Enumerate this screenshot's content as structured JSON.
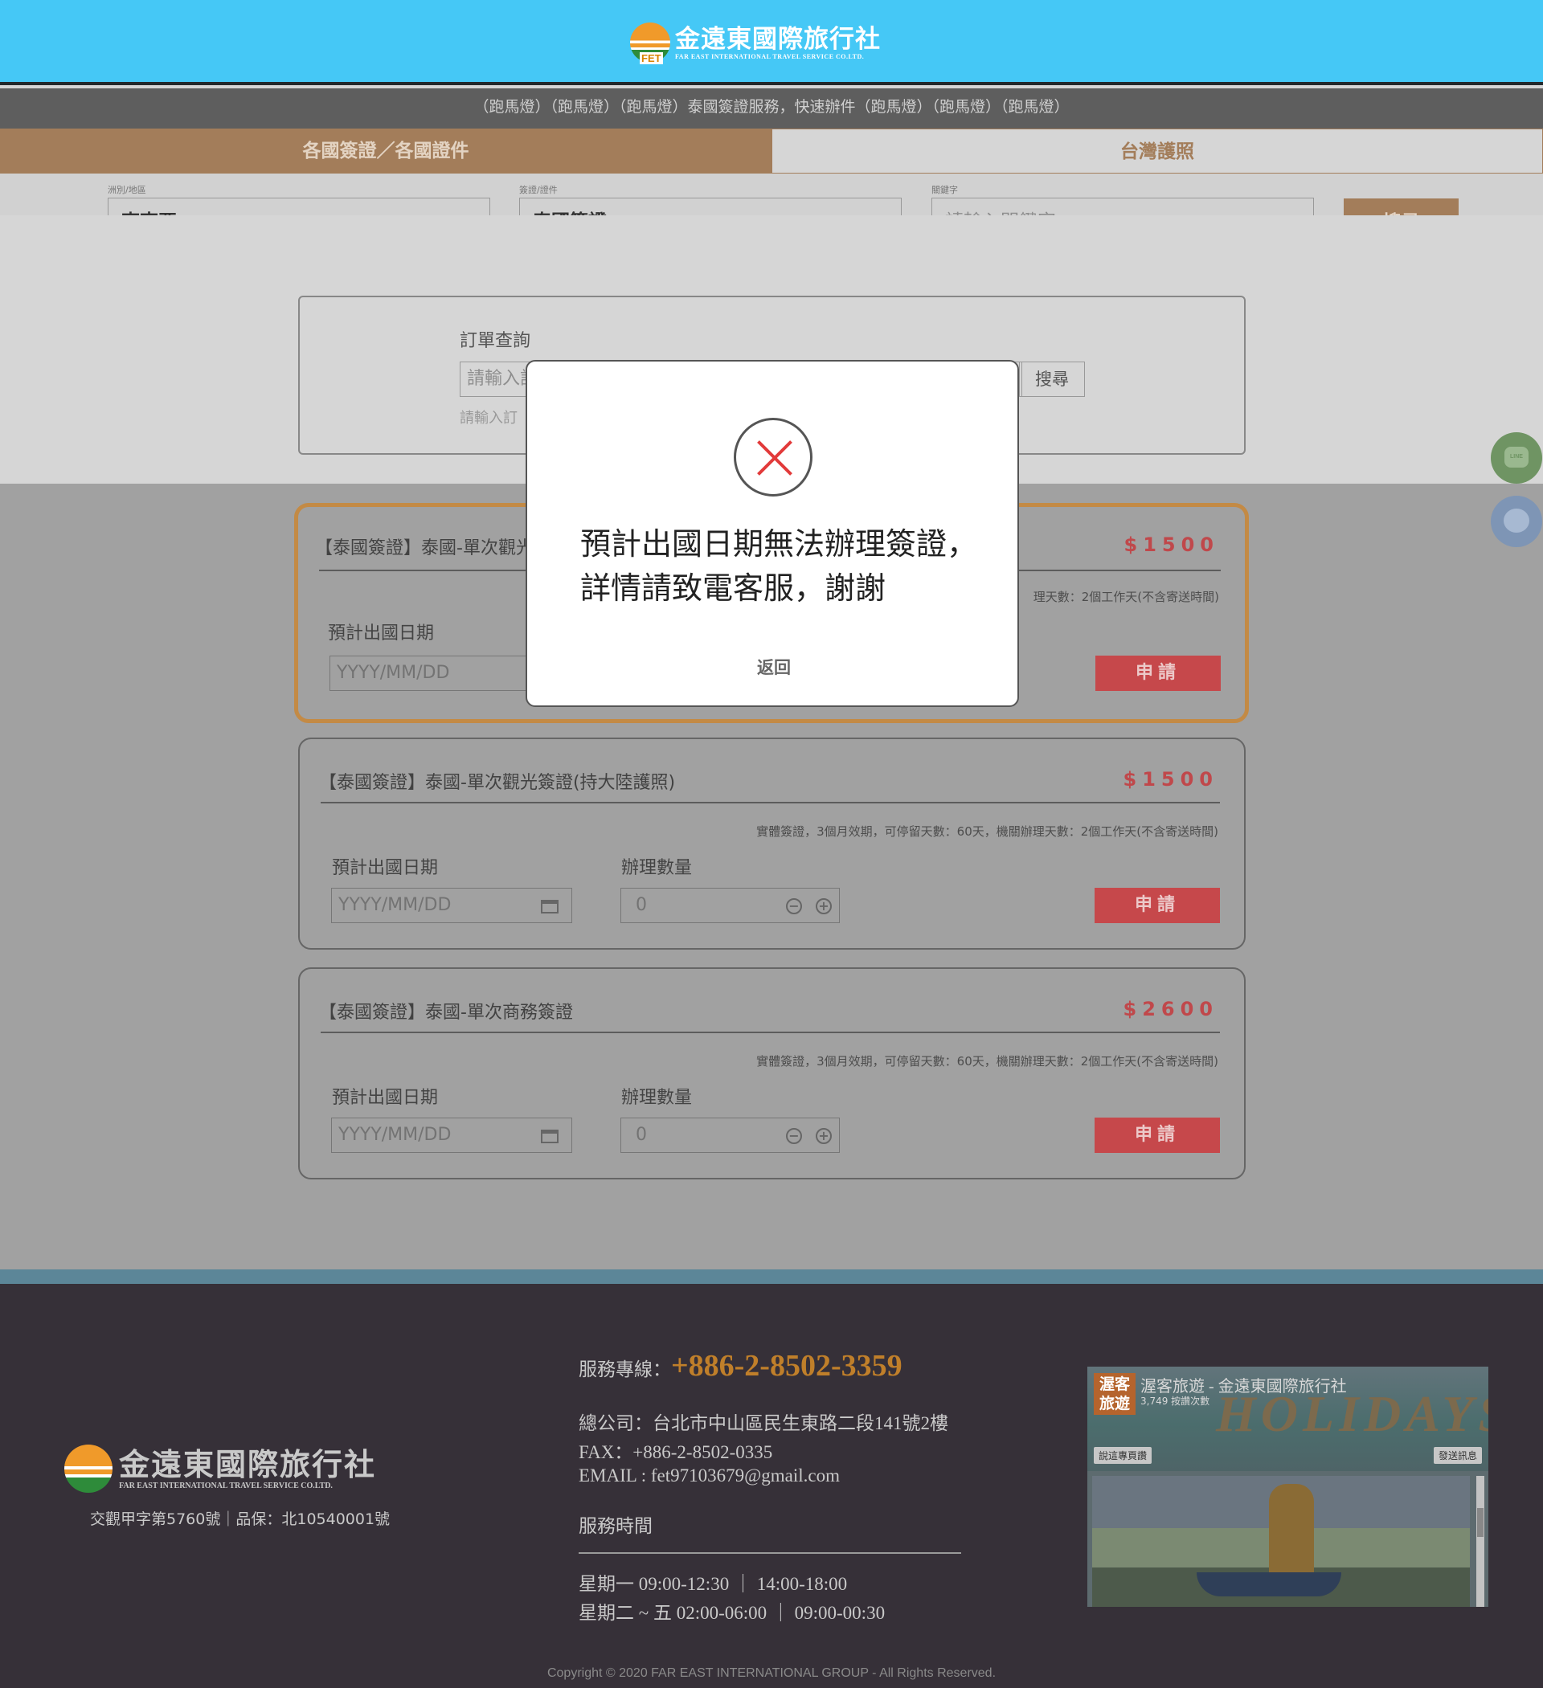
{
  "header": {
    "logo_cn": "金遠東國際旅行社",
    "logo_en": "FAR EAST INTERNATIONAL TRAVEL SERVICE CO.LTD.",
    "logo_mark": "FET"
  },
  "marquee": "（跑馬燈）（跑馬燈）（跑馬燈）泰國簽證服務，快速辦件（跑馬燈）（跑馬燈）（跑馬燈）",
  "tabs": [
    {
      "label": "各國簽證／各國證件",
      "active": true
    },
    {
      "label": "台灣護照",
      "active": false
    }
  ],
  "filter": {
    "region_label": "洲別/地區",
    "region_value": "東南亞",
    "visa_label": "簽證/證件",
    "visa_value": "泰國簽證",
    "keyword_label": "關鍵字",
    "keyword_placeholder": "請輸入關鍵字",
    "search_label": "搜尋"
  },
  "order_query": {
    "title": "訂單查詢",
    "input_placeholder": "請輸入訂",
    "search_label": "搜尋",
    "hint": "請輸入訂"
  },
  "products": [
    {
      "title": "【泰國簽證】泰國-單次觀光",
      "price": "$1500",
      "desc": "理天數：2個工作天(不含寄送時間)",
      "date_label": "預計出國日期",
      "date_placeholder": "YYYY/MM/DD",
      "apply_label": "申請",
      "highlighted": true
    },
    {
      "title": "【泰國簽證】泰國-單次觀光簽證(持大陸護照)",
      "price": "$1500",
      "desc": "實體簽證，3個月效期，可停留天數：60天，機關辦理天數：2個工作天(不含寄送時間)",
      "date_label": "預計出國日期",
      "qty_label": "辦理數量",
      "date_placeholder": "YYYY/MM/DD",
      "qty_value": "0",
      "apply_label": "申請",
      "highlighted": false
    },
    {
      "title": "【泰國簽證】泰國-單次商務簽證",
      "price": "$2600",
      "desc": "實體簽證，3個月效期，可停留天數：60天，機關辦理天數：2個工作天(不含寄送時間)",
      "date_label": "預計出國日期",
      "qty_label": "辦理數量",
      "date_placeholder": "YYYY/MM/DD",
      "qty_value": "0",
      "apply_label": "申請",
      "highlighted": false
    }
  ],
  "side_buttons": [
    {
      "name": "line-icon",
      "label": "LINE"
    },
    {
      "name": "messenger-icon"
    }
  ],
  "modal": {
    "icon": "error-x-icon",
    "message": "預計出國日期無法辦理簽證，詳情請致電客服，謝謝",
    "back_label": "返回"
  },
  "footer": {
    "logo_cn": "金遠東國際旅行社",
    "logo_en": "FAR EAST INTERNATIONAL TRAVEL SERVICE CO.LTD.",
    "license": "交觀甲字第5760號｜品保：北10540001號",
    "hotline_label": "服務專線：",
    "hotline": "+886-2-8502-3359",
    "address": "總公司：台北市中山區民生東路二段141號2樓",
    "fax": "FAX：+886-2-8502-0335",
    "email": "EMAIL : fet97103679@gmail.com",
    "hours_title": "服務時間",
    "hours_1": "星期一  09:00-12:30 ｜ 14:00-18:00",
    "hours_2": "星期二 ~ 五  02:00-06:00 ｜ 09:00-00:30",
    "fb_brand": "渥客旅遊",
    "fb_name": "渥客旅遊 - 金遠東國際旅行社",
    "fb_likes": "3,749 按讚次數",
    "fb_banner": "HOLIDAYS",
    "fb_like_btn": "說這專頁讚",
    "fb_msg_btn": "發送訊息",
    "copyright": "Copyright © 2020 FAR EAST INTERNATIONAL GROUP - All Rights Reserved."
  }
}
